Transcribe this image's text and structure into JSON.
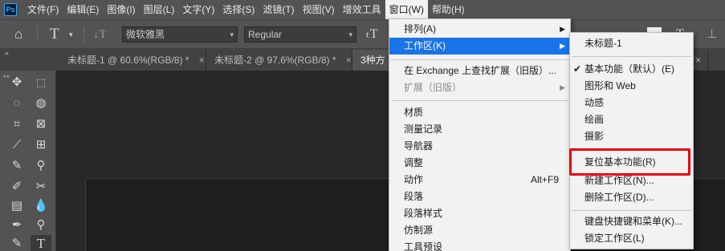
{
  "menubar": {
    "logo": "Ps",
    "items": [
      "文件(F)",
      "编辑(E)",
      "图像(I)",
      "图层(L)",
      "文字(Y)",
      "选择(S)",
      "滤镜(T)",
      "视图(V)",
      "增效工具",
      "窗口(W)",
      "帮助(H)"
    ],
    "active_item": "窗口(W)"
  },
  "options": {
    "font_family": "微软雅黑",
    "font_style": "Regular"
  },
  "tabs": [
    {
      "label": "未标题-1 @ 60.6%(RGB/8) *",
      "close": "×"
    },
    {
      "label": "未标题-2 @ 97.6%(RGB/8) *",
      "close": "×"
    },
    {
      "label": "3种方"
    }
  ],
  "window_menu": {
    "items": [
      {
        "label": "排列(A)",
        "submenu": true
      },
      {
        "label": "工作区(K)",
        "submenu": true,
        "highlighted": true
      },
      {
        "label": "在 Exchange 上查找扩展（旧版）..."
      },
      {
        "label": "扩展（旧版）",
        "submenu": true,
        "disabled": true
      },
      {
        "label": "材质"
      },
      {
        "label": "测量记录"
      },
      {
        "label": "导航器"
      },
      {
        "label": "调整"
      },
      {
        "label": "动作",
        "shortcut": "Alt+F9"
      },
      {
        "label": "段落"
      },
      {
        "label": "段落样式"
      },
      {
        "label": "仿制源"
      },
      {
        "label": "工具预设"
      }
    ]
  },
  "workspace_menu": {
    "items": [
      {
        "label": "未标题-1"
      },
      {
        "label": "基本功能（默认）(E)",
        "checked": true
      },
      {
        "label": "图形和 Web"
      },
      {
        "label": "动感"
      },
      {
        "label": "绘画"
      },
      {
        "label": "摄影"
      },
      {
        "label": "复位基本功能(R)",
        "boxed": true
      },
      {
        "label": "新建工作区(N)..."
      },
      {
        "label": "删除工作区(D)..."
      },
      {
        "label": "键盘快捷键和菜单(K)..."
      },
      {
        "label": "锁定工作区(L)"
      }
    ]
  },
  "colors": {
    "highlight": "#1a73e8",
    "annotation_box": "#e60012",
    "chrome": "#535353"
  }
}
